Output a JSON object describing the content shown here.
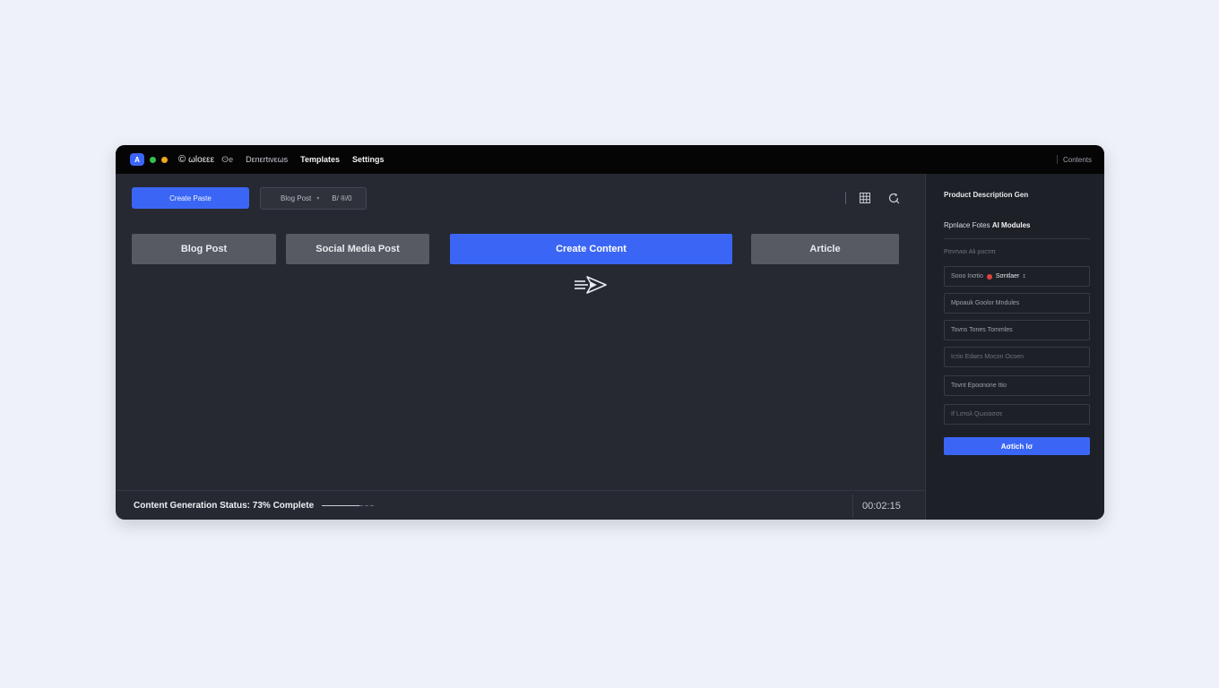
{
  "titlebar": {
    "app_logo": "A",
    "brand_mark": "©",
    "brand": "ωloεεε",
    "brand_sub": "ⵙe",
    "nav": [
      "Dεnεrtινεωs",
      "Templates",
      "Settings"
    ],
    "right_link": "Contents"
  },
  "toolbar": {
    "create_button": "Create Paste",
    "selector_label": "Blog Post",
    "selector_caret": "▾",
    "selector_value": "B/ ®/0"
  },
  "content_types": [
    {
      "label": "Blog Post",
      "active": false
    },
    {
      "label": "Social Media Post",
      "active": false
    },
    {
      "label": "Create Content",
      "active": true
    },
    {
      "label": "Article",
      "active": false
    }
  ],
  "status": {
    "text": "Content Generation Status: 73% Complete",
    "progress_fraction": 0.73,
    "timer": "00:02:15"
  },
  "panel": {
    "title": "Product Description Gen",
    "subtitle_prefix": "Rpnlace Fotes",
    "subtitle_strong": "AI Modules",
    "section_label": "Pσvτνιοι Alι ροcτιπ",
    "fields": [
      {
        "text": "Sooo Inσtio",
        "badge": true,
        "extra": "Sσntlaer",
        "tail": "ɪ",
        "dim": false
      },
      {
        "text": "Mpoauk Goolor Mndules",
        "badge": false,
        "extra": "",
        "tail": "",
        "dim": false
      },
      {
        "text": "Tovns Tones Tommles",
        "badge": false,
        "extra": "",
        "tail": "",
        "dim": false
      },
      {
        "text": "Icτio Edaes Mocon Ocoen",
        "badge": false,
        "extra": "",
        "tail": "",
        "dim": true
      },
      {
        "text": "Tovnt Epoonone Itio",
        "badge": false,
        "extra": "",
        "tail": "",
        "dim": false
      },
      {
        "text": "Ιf Lστολ Qωειασσε",
        "badge": false,
        "extra": "",
        "tail": "",
        "dim": true
      }
    ],
    "button": "Aσtich Iσ"
  },
  "colors": {
    "accent": "#3b66f5",
    "window_bg": "#262932",
    "titlebar_bg": "#050506",
    "panel_bg": "#1e2028",
    "inactive_button": "#575a62",
    "page_bg": "#eef1f8"
  },
  "icons": [
    "grid-icon",
    "search-refresh-icon",
    "send-arrow-icon"
  ]
}
